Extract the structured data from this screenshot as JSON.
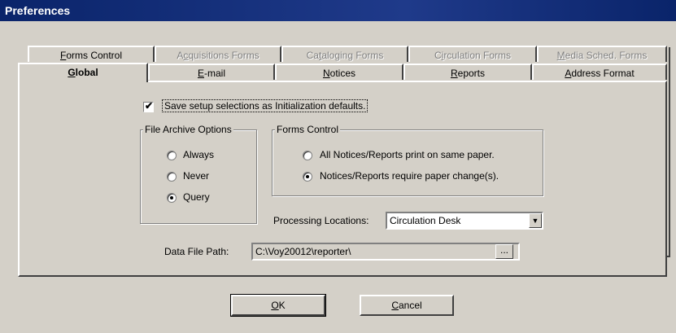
{
  "window": {
    "title": "Preferences"
  },
  "tabs": {
    "row1": [
      {
        "pre": "",
        "ul": "F",
        "post": "orms Control",
        "disabled": false
      },
      {
        "pre": "A",
        "ul": "c",
        "post": "quisitions Forms",
        "disabled": true
      },
      {
        "pre": "Ca",
        "ul": "t",
        "post": "aloging Forms",
        "disabled": true
      },
      {
        "pre": "C",
        "ul": "i",
        "post": "rculation Forms",
        "disabled": true
      },
      {
        "pre": "",
        "ul": "M",
        "post": "edia Sched. Forms",
        "disabled": true
      }
    ],
    "row2": [
      {
        "pre": "",
        "ul": "G",
        "post": "lobal",
        "active": true
      },
      {
        "pre": "",
        "ul": "E",
        "post": "-mail"
      },
      {
        "pre": "",
        "ul": "N",
        "post": "otices"
      },
      {
        "pre": "",
        "ul": "R",
        "post": "eports"
      },
      {
        "pre": "",
        "ul": "A",
        "post": "ddress Format"
      }
    ]
  },
  "global": {
    "save_defaults": {
      "label": "Save setup selections as Initialization defaults.",
      "checked": true
    },
    "file_archive": {
      "title": "File Archive Options",
      "options": [
        "Always",
        "Never",
        "Query"
      ],
      "selected": "Query"
    },
    "forms_control": {
      "title": "Forms Control",
      "options": [
        "All Notices/Reports print on same paper.",
        "Notices/Reports require paper change(s)."
      ],
      "selected": "Notices/Reports require paper change(s)."
    },
    "processing_locations": {
      "label": "Processing Locations:",
      "value": "Circulation Desk"
    },
    "data_file_path": {
      "label": "Data File Path:",
      "value": "C:\\Voy20012\\reporter\\",
      "browse_label": "..."
    }
  },
  "buttons": {
    "ok": {
      "pre": "",
      "ul": "O",
      "post": "K"
    },
    "cancel": {
      "pre": "",
      "ul": "C",
      "post": "ancel"
    }
  }
}
